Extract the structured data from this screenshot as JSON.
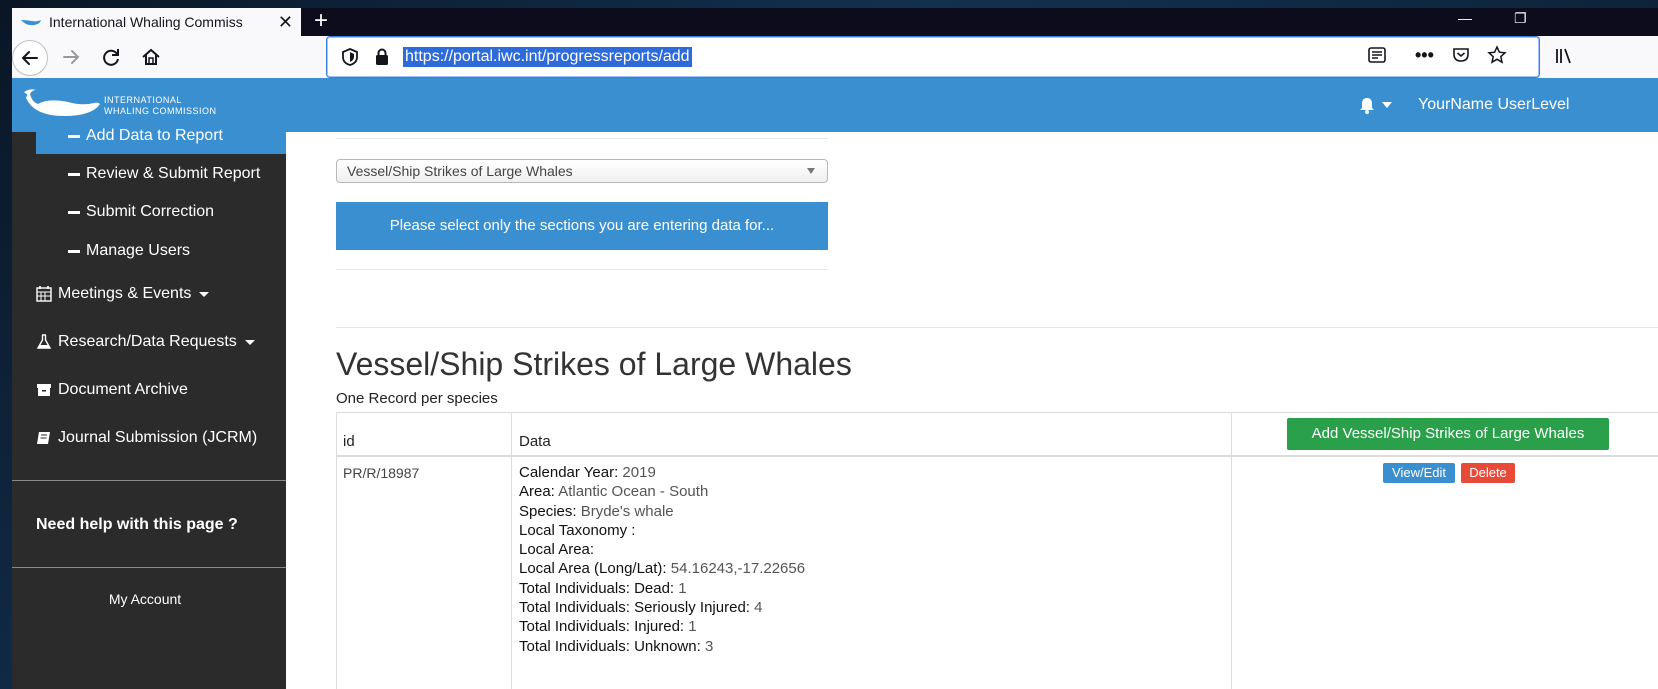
{
  "browser": {
    "tab_title": "International Whaling Commiss",
    "url": "https://portal.iwc.int/progressreports/add",
    "new_tab": "+",
    "minimize": "—",
    "restore": "❐"
  },
  "site": {
    "logo_line1": "INTERNATIONAL",
    "logo_line2": "WHALING COMMISSION",
    "user": "YourName UserLevel"
  },
  "sidebar": {
    "sub_items": [
      {
        "label": "Add Data to Report",
        "active": true
      },
      {
        "label": "Review & Submit Report"
      },
      {
        "label": "Submit Correction"
      },
      {
        "label": "Manage Users"
      }
    ],
    "main_items": [
      {
        "label": "Meetings & Events",
        "icon": "calendar-icon"
      },
      {
        "label": "Research/Data Requests",
        "icon": "flask-icon"
      },
      {
        "label": "Document Archive",
        "icon": "archive-icon"
      },
      {
        "label": "Journal Submission (JCRM)",
        "icon": "book-icon"
      }
    ],
    "help": "Need help with this page",
    "help_mark": "?",
    "my_account": "My Account"
  },
  "main": {
    "section_select": "Vessel/Ship Strikes of Large Whales",
    "info_message": "Please select only the sections you are entering data for...",
    "section_title": "Vessel/Ship Strikes of Large Whales",
    "section_subtitle": "One Record per species",
    "table": {
      "col_id": "id",
      "col_data": "Data",
      "add_button": "Add Vessel/Ship Strikes of Large Whales",
      "rows": [
        {
          "id": "PR/R/18987",
          "fields": [
            {
              "label": "Calendar Year:",
              "value": "2019"
            },
            {
              "label": "Area:",
              "value": "Atlantic Ocean - South"
            },
            {
              "label": "Species:",
              "value": "Bryde's whale"
            },
            {
              "label": "Local Taxonomy :",
              "value": ""
            },
            {
              "label": "Local Area:",
              "value": ""
            },
            {
              "label": "Local Area (Long/Lat):",
              "value": "54.16243,-17.22656"
            },
            {
              "label": "Total Individuals: Dead:",
              "value": "1"
            },
            {
              "label": "Total Individuals: Seriously Injured:",
              "value": "4"
            },
            {
              "label": "Total Individuals: Injured:",
              "value": "1"
            },
            {
              "label": "Total Individuals: Unknown:",
              "value": "3"
            }
          ],
          "view_edit": "View/Edit",
          "delete": "Delete"
        }
      ]
    }
  }
}
